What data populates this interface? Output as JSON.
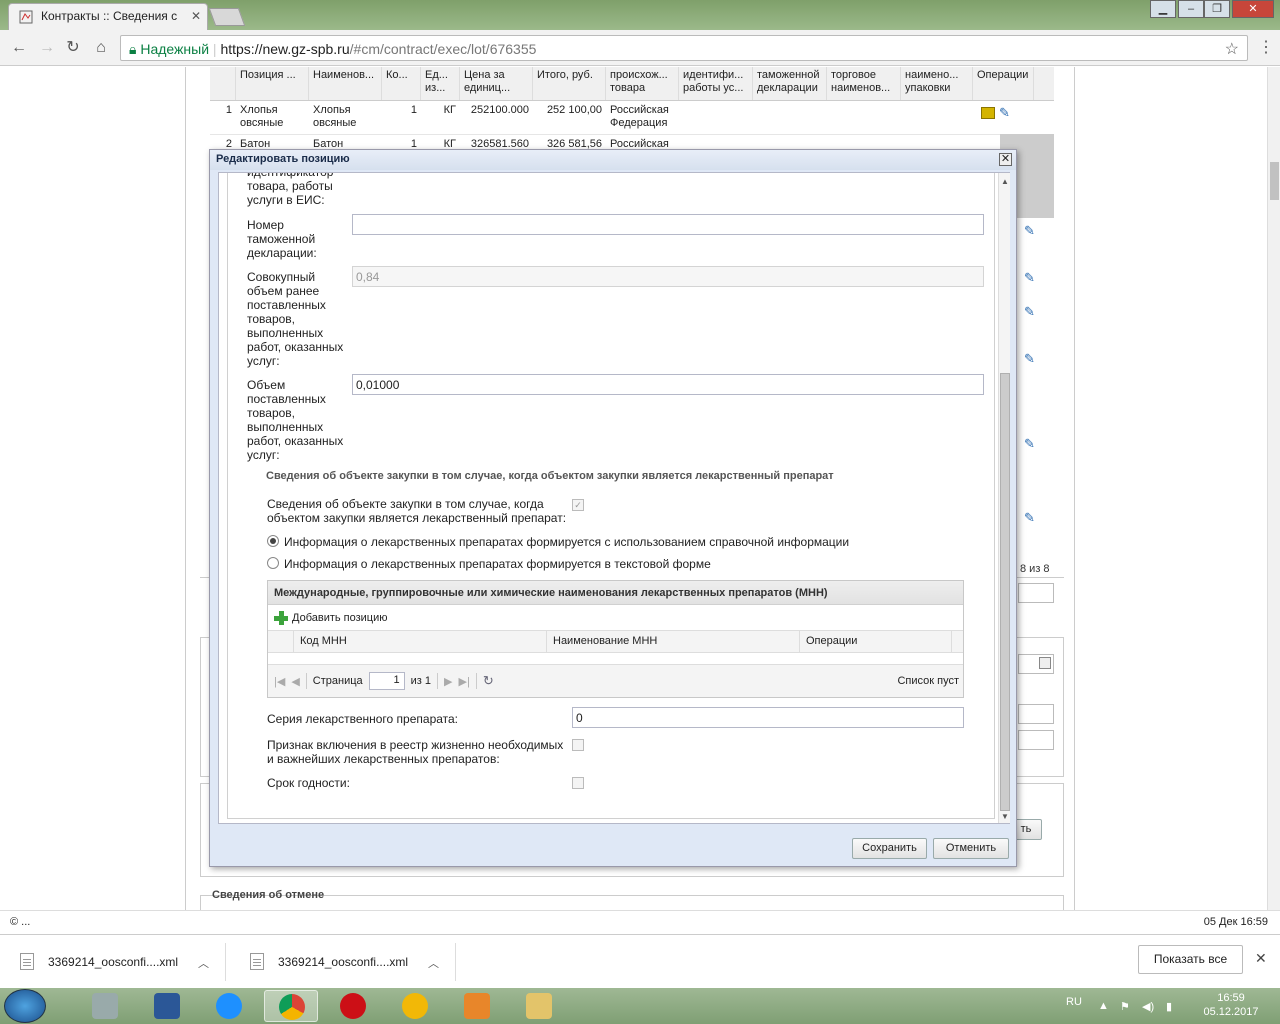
{
  "browser": {
    "tab_title": "Контракты :: Сведения с",
    "secure_label": "Надежный",
    "url_host": "https://new.gz-spb.ru",
    "url_path": "/#cm/contract/exec/lot/676355"
  },
  "bg_table": {
    "headers": [
      "Позиция ...",
      "Наименов...",
      "Ко...",
      "Ед... из...",
      "Цена за единиц...",
      "Итого, руб.",
      "происхож... товара",
      "идентифи... работы ус...",
      "таможенной декларации",
      "торговое наименов...",
      "наимено... упаковки",
      "Операции"
    ],
    "rows": [
      {
        "n": "1",
        "pos": "Хлопья овсяные",
        "name": "Хлопья овсяные",
        "qty": "1",
        "unit": "КГ",
        "price": "252100.000",
        "total": "252 100,00",
        "origin": "Российская Федерация"
      },
      {
        "n": "2",
        "pos": "Батон",
        "name": "Батон",
        "qty": "1",
        "unit": "КГ",
        "price": "326581.560",
        "total": "326 581,56",
        "origin": "Российская"
      }
    ],
    "pager": "8 из 8",
    "cancel_legend": "Сведения об отмене",
    "partial_button": "ть"
  },
  "modal": {
    "title": "Редактировать позицию",
    "label_identifier": "идентификатор товара, работы услуги в ЕИС:",
    "label_customs": "Номер таможенной декларации:",
    "customs_value": "",
    "label_cumulative": "Совокупный объем ранее поставленных товаров, выполненных работ, оказанных услуг:",
    "cumulative_value": "0,84",
    "label_volume": "Объем поставленных товаров, выполненных работ, оказанных услуг:",
    "volume_value": "0,01000",
    "drug_section_title": "Сведения об объекте закупки в том случае, когда объектом закупки является лекарственный препарат",
    "drug_checkbox_label": "Сведения об объекте закупки в том случае, когда объектом закупки является лекарственный препарат:",
    "radio_ref": "Информация о лекарственных препаратах формируется с использованием справочной информации",
    "radio_text": "Информация о лекарственных препаратах формируется в текстовой форме",
    "mnn_title": "Международные, группировочные или химические наименования лекарственных препаратов (МНН)",
    "mnn_add": "Добавить позицию",
    "mnn_col_code": "Код МНН",
    "mnn_col_name": "Наименование МНН",
    "mnn_col_ops": "Операции",
    "pager_page": "Страница",
    "pager_value": "1",
    "pager_of": "из 1",
    "pager_empty": "Список пуст",
    "label_series": "Серия лекарственного препарата:",
    "series_value": "0",
    "label_registry": "Признак включения в реестр жизненно необходимых и важнейших лекарственных препаратов:",
    "label_expiry": "Срок годности:",
    "save": "Сохранить",
    "cancel": "Отменить"
  },
  "status": {
    "left": "© ...",
    "right": "05 Дек 16:59"
  },
  "downloads": {
    "item1": "3369214_oosconfi....xml",
    "item2": "3369214_oosconfi....xml",
    "show_all": "Показать все"
  },
  "taskbar": {
    "lang": "RU",
    "time": "16:59",
    "date": "05.12.2017"
  }
}
